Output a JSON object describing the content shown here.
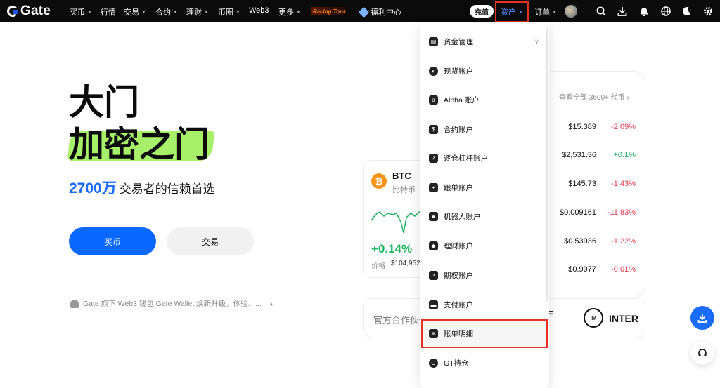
{
  "header": {
    "logo": "Gate",
    "nav": [
      {
        "label": "买币",
        "caret": true
      },
      {
        "label": "行情",
        "caret": false
      },
      {
        "label": "交易",
        "caret": true
      },
      {
        "label": "合约",
        "caret": true
      },
      {
        "label": "理财",
        "caret": true
      },
      {
        "label": "币圈",
        "caret": true
      },
      {
        "label": "Web3",
        "caret": false
      },
      {
        "label": "更多",
        "caret": true
      }
    ],
    "racing_badge": "Racing Tour",
    "welfare": "福利中心",
    "deposit": "充值",
    "assets": "资产",
    "orders": "订单",
    "icons": [
      "search-icon",
      "download-icon",
      "bell-icon",
      "globe-icon",
      "moon-icon",
      "gear-icon"
    ]
  },
  "hero": {
    "title_line1": "大门",
    "title_line2": "加密之门",
    "sub_number": "2700万",
    "sub_text": "交易者的信赖首选",
    "buy_label": "买币",
    "trade_label": "交易",
    "notice": "Gate 旗下 Web3 钱包 Gate Wallet 焕新升级，体验、..."
  },
  "market": {
    "view_all": "查看全部 3600+ 代币",
    "rows": [
      {
        "price": "$15.389",
        "change": "-2.09%",
        "dir": "down"
      },
      {
        "price": "$2,531.36",
        "change": "+0.1%",
        "dir": "up"
      },
      {
        "price": "$145.73",
        "change": "-1.43%",
        "dir": "down"
      },
      {
        "price": "$0.009161",
        "change": "-11.83%",
        "dir": "down"
      },
      {
        "price": "$0.53936",
        "change": "-1.22%",
        "dir": "down"
      },
      {
        "price": "$0.9977",
        "change": "-0.01%",
        "dir": "down"
      }
    ]
  },
  "btc": {
    "symbol": "BTC",
    "name": "比特币",
    "icon": "₿",
    "change": "+0.14%",
    "price_label": "价格",
    "price": "$104,952"
  },
  "partner": {
    "label": "官方合作伙伴",
    "inter_text": "INTER",
    "inter_logo": "IM"
  },
  "dropdown": {
    "items": [
      {
        "label": "资金管理",
        "icon": "wallet-icon"
      },
      {
        "label": "现货账户",
        "icon": "spot-icon"
      },
      {
        "label": "Alpha 账户",
        "icon": "alpha-icon"
      },
      {
        "label": "合约账户",
        "icon": "futures-icon"
      },
      {
        "label": "逐仓杠杆账户",
        "icon": "margin-icon"
      },
      {
        "label": "跟单账户",
        "icon": "copy-trade-icon"
      },
      {
        "label": "机器人账户",
        "icon": "robot-icon"
      },
      {
        "label": "理财账户",
        "icon": "earn-icon"
      },
      {
        "label": "期权账户",
        "icon": "options-icon"
      },
      {
        "label": "支付账户",
        "icon": "pay-icon"
      },
      {
        "label": "账单明细",
        "icon": "bill-icon"
      },
      {
        "label": "GT持仓",
        "icon": "gt-icon"
      }
    ]
  },
  "colors": {
    "accent": "#0a68ff",
    "up": "#1cb35e",
    "down": "#e8394c",
    "highlight": "#a8f06a",
    "annotation": "#e53222"
  }
}
